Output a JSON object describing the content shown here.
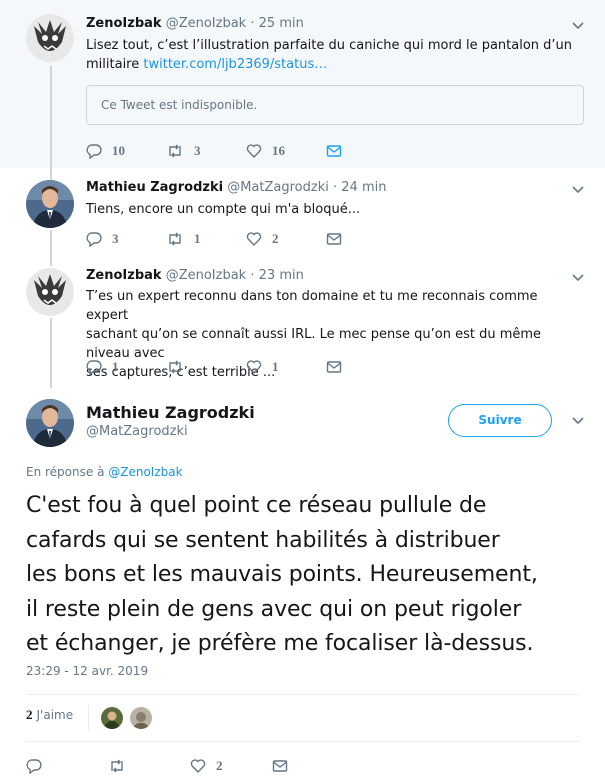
{
  "tweets": [
    {
      "name": "ZenoIzbak",
      "handle": "@ZenoIzbak",
      "dot": "·",
      "time": "25 min",
      "text_line1": "Lisez tout, c’est l’illustration parfaite du caniche qui mord le pantalon d’un",
      "text_line2_prefix": "militaire ",
      "link": "twitter.com/ljb2369/status…",
      "quote": "Ce Tweet est indisponible.",
      "replies": "10",
      "retweets": "3",
      "likes": "16"
    },
    {
      "name": "Mathieu Zagrodzki",
      "handle": "@MatZagrodzki",
      "dot": "·",
      "time": "24 min",
      "text": "Tiens, encore un compte qui m'a bloqué...",
      "replies": "3",
      "retweets": "1",
      "likes": "2"
    },
    {
      "name": "ZenoIzbak",
      "handle": "@ZenoIzbak",
      "dot": "·",
      "time": "23 min",
      "text_line1": "T’es un expert reconnu dans ton domaine et tu me reconnais comme expert",
      "text_line2": "sachant qu’on se connaît aussi IRL. Le mec pense qu’on est du même niveau avec",
      "text_line3": "ses captures, c’est terrible ...",
      "replies": "1",
      "retweets": "",
      "likes": "1"
    }
  ],
  "main": {
    "name": "Mathieu Zagrodzki",
    "handle": "@MatZagrodzki",
    "follow_label": "Suivre",
    "reply_prefix": "En réponse à ",
    "reply_handle": "@ZenoIzbak",
    "text_line1": "C'est fou à quel point ce réseau pullule de",
    "text_line2": "cafards qui se sentent habilités à distribuer",
    "text_line3": "les bons et les mauvais points. Heureusement,",
    "text_line4": "il reste plein de gens avec qui on peut rigoler",
    "text_line5": "et échanger, je préfère me focaliser là-dessus.",
    "date": "23:29 - 12 avr. 2019",
    "likes_count": "2",
    "likes_label": "J'aime",
    "replies": "",
    "retweets": "",
    "likes": "2"
  },
  "colors": {
    "accent": "#1da1f2",
    "link": "#1b95e0",
    "muted": "#657786",
    "thread_bg": "#f5f8fa"
  }
}
